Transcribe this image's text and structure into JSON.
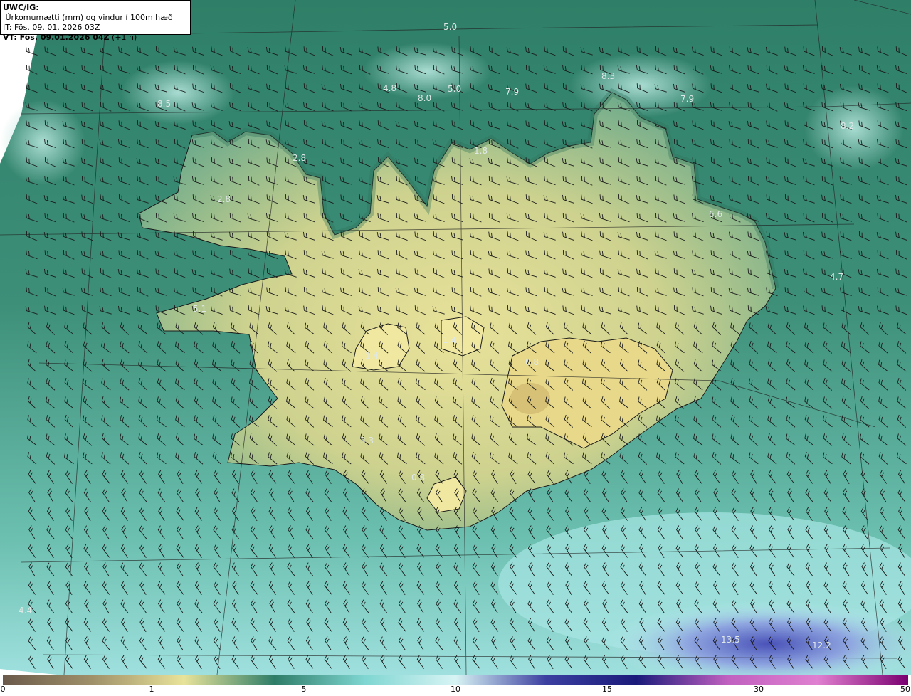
{
  "header": {
    "model_label": "UWC/IG:",
    "title_text": " Úrkomumætti (mm) og vindur í 100m hæð",
    "init_text": "IT: Fös. 09. 01. 2026 03Z",
    "valid_label": "VT: Fös. 09.01.2026 04Z",
    "valid_suffix": " (+1 h)"
  },
  "map": {
    "value_labels": [
      "5.0",
      "4.8",
      "8.0",
      "5.0",
      "7.9",
      "8.3",
      "7.9",
      "8.2",
      "8.5",
      "2.8",
      "2.8",
      "1.8",
      "6.6",
      "4.7",
      "5.1",
      "1.4",
      "1.4",
      "0.8",
      "3.3",
      "0.8",
      "4.4",
      "13.5",
      "12.2"
    ]
  },
  "colorbar": {
    "ticks": [
      "0",
      "1",
      "5",
      "10",
      "15",
      "30",
      "50"
    ],
    "colors": [
      "#6b5a4a",
      "#a0916a",
      "#e8e39a",
      "#2e7d68",
      "#7fd6d2",
      "#d8f4f4",
      "#3b3fa0",
      "#1a1a7a",
      "#c060c0",
      "#e080d0",
      "#7a0070"
    ]
  }
}
